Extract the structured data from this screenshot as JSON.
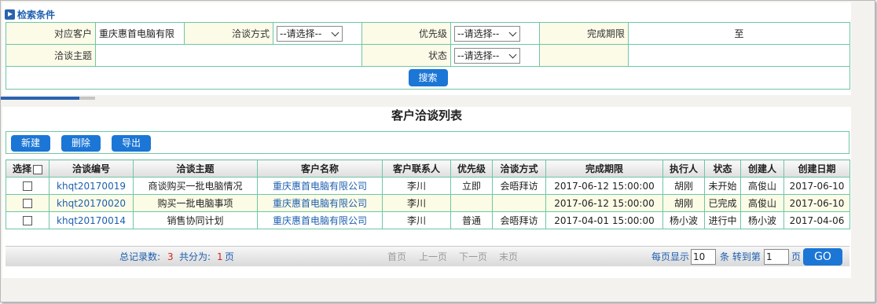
{
  "search_panel": {
    "title": "检索条件",
    "customer_label": "对应客户",
    "customer_value": "重庆惠首电脑有限",
    "method_label": "洽谈方式",
    "method_value": "--请选择--",
    "priority_label": "优先级",
    "priority_value": "--请选择--",
    "deadline_label": "完成期限",
    "deadline_sep": "至",
    "topic_label": "洽谈主题",
    "topic_value": "",
    "status_label": "状态",
    "status_value": "--请选择--",
    "search_button": "搜索"
  },
  "progress": {
    "fraction": 0.83
  },
  "list": {
    "title": "客户洽谈列表",
    "toolbar": {
      "new": "新建",
      "delete": "删除",
      "export": "导出"
    },
    "columns": [
      "选择",
      "洽谈编号",
      "洽谈主题",
      "客户名称",
      "客户联系人",
      "优先级",
      "洽谈方式",
      "完成期限",
      "执行人",
      "状态",
      "创建人",
      "创建日期"
    ],
    "rows": [
      [
        "khqt20170019",
        "商谈购买一批电脑情况",
        "重庆惠首电脑有限公司",
        "李川",
        "立即",
        "会晤拜访",
        "2017-06-12 15:00:00",
        "胡刚",
        "未开始",
        "高俊山",
        "2017-06-10"
      ],
      [
        "khqt20170020",
        "购买一批电脑事项",
        "重庆惠首电脑有限公司",
        "李川",
        "",
        "",
        "2017-06-12 15:00:00",
        "胡刚",
        "已完成",
        "高俊山",
        "2017-06-10"
      ],
      [
        "khqt20170014",
        "销售协同计划",
        "重庆惠首电脑有限公司",
        "李川",
        "普通",
        "会晤拜访",
        "2017-04-01 15:00:00",
        "杨小波",
        "进行中",
        "杨小波",
        "2017-04-06"
      ]
    ]
  },
  "pager": {
    "total_label": "总记录数:",
    "total_count": "3",
    "pages_label": "共分为:",
    "pages_count": "1",
    "pages_unit": "页",
    "first": "首页",
    "prev": "上一页",
    "next": "下一页",
    "last": "末页",
    "per_page_label": "每页显示",
    "per_page_value": "10",
    "goto_label": "条 转到第",
    "goto_value": "1",
    "goto_unit": "页",
    "go_button": "GO"
  }
}
